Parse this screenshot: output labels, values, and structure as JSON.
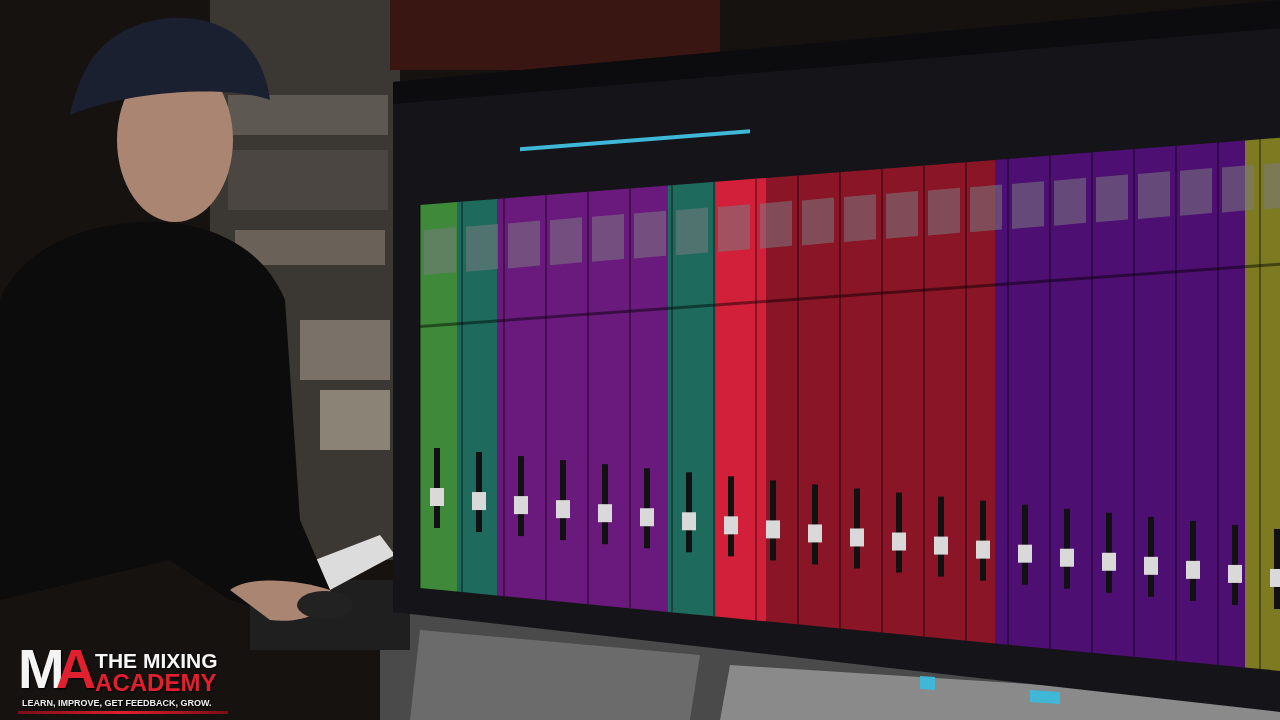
{
  "video_frame": {
    "logo_overlay": {
      "monogram": "MA",
      "title_lines": [
        "THE MIXING",
        "ACADEMY"
      ],
      "tagline": "LEARN, IMPROVE, GET FEEDBACK, GROW."
    }
  }
}
